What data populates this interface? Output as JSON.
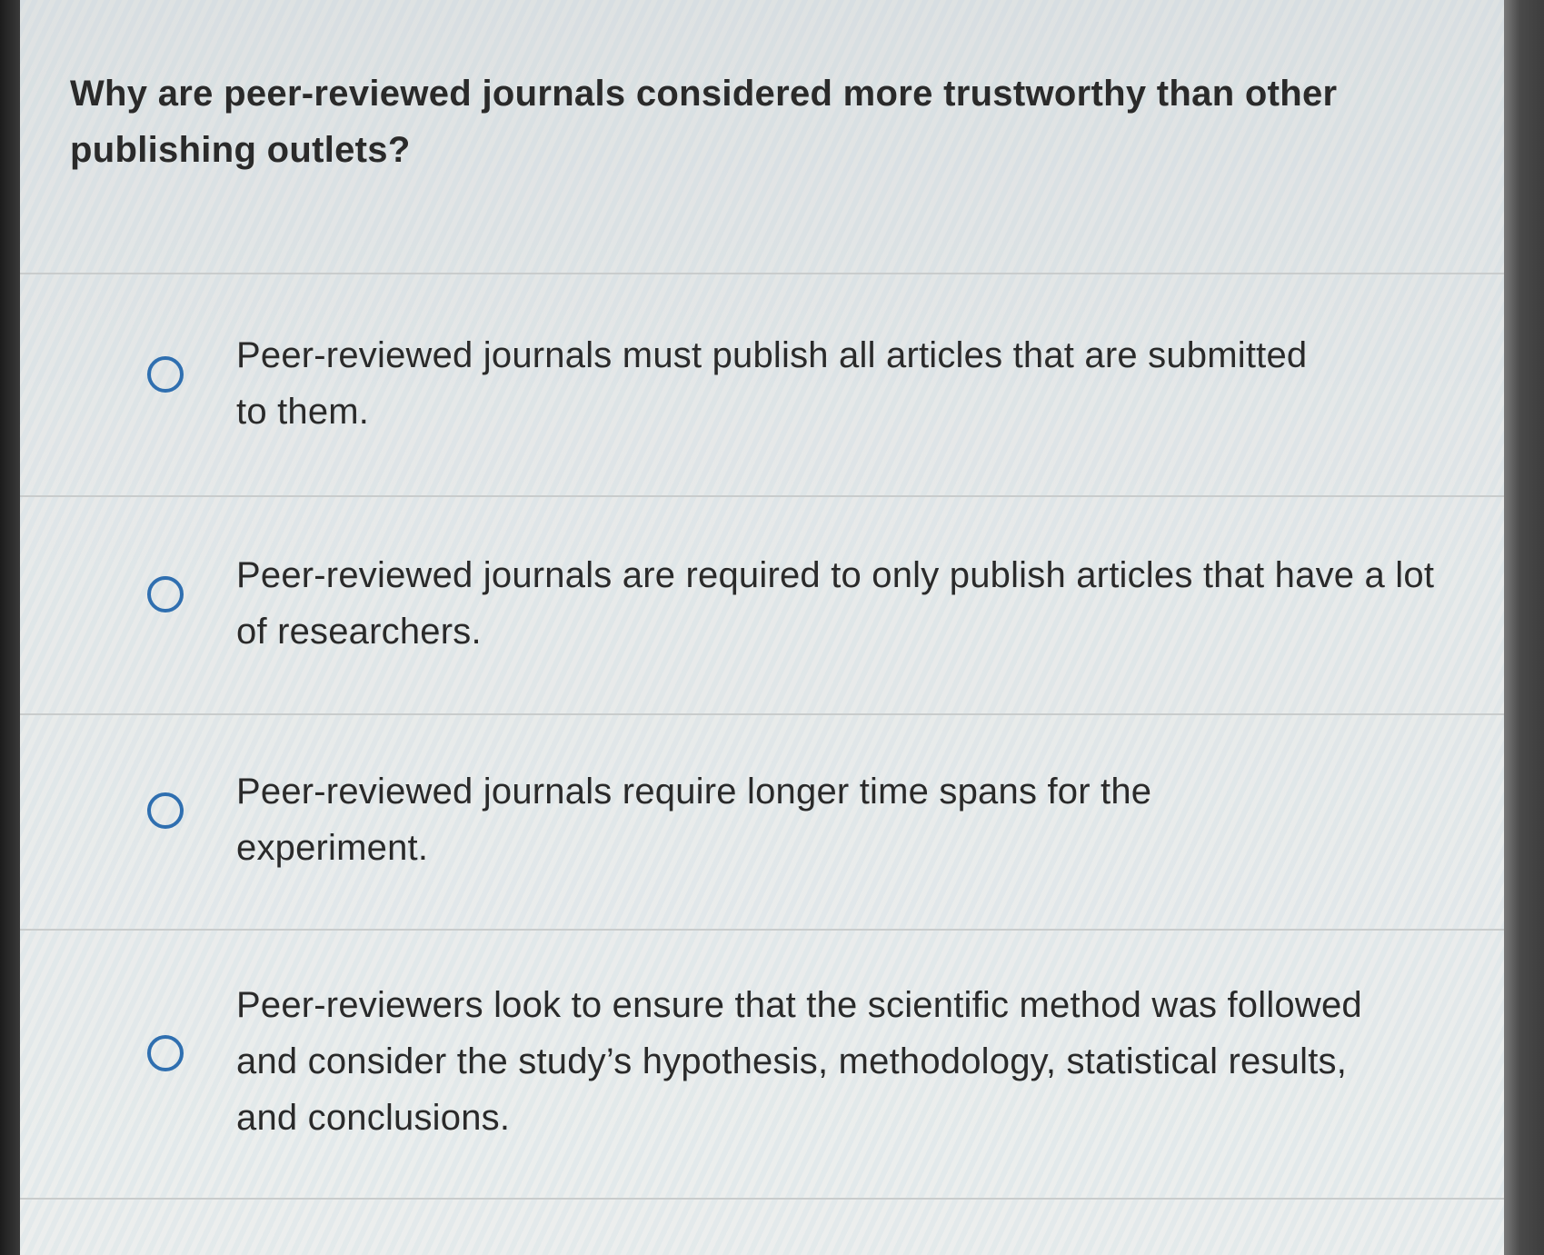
{
  "question": {
    "text": "Why are peer-reviewed journals considered more trustworthy than other publishing outlets?"
  },
  "options": [
    {
      "label": "Peer-reviewed journals must publish all articles that are submitted to them."
    },
    {
      "label": "Peer-reviewed journals are required to only publish articles that have a lot of researchers."
    },
    {
      "label": "Peer-reviewed journals require longer time spans for the experiment."
    },
    {
      "label": "Peer-reviewers look to ensure that the scientific method was followed and consider the study’s hypothesis, methodology, statistical results, and conclusions."
    }
  ],
  "colors": {
    "radio_border": "#2f6fb0",
    "text": "#2a2a2a",
    "divider": "#c9cccc"
  }
}
